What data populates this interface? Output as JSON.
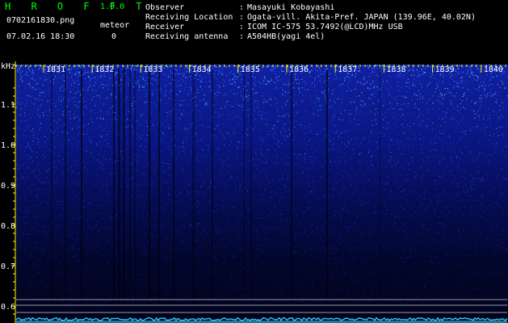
{
  "app": {
    "title": "H R O F F T",
    "version": "1.0.0"
  },
  "file": {
    "name": "0702161830.png",
    "datetime": "07.02.16 18:30"
  },
  "meteor": {
    "label": "meteor",
    "count": "0"
  },
  "info": [
    {
      "label": "Observer",
      "value": "Masayuki Kobayashi"
    },
    {
      "label": "Receiving Location",
      "value": "Ogata-vill. Akita-Pref. JAPAN (139.96E, 40.02N)"
    },
    {
      "label": "Receiver",
      "value": "ICOM IC-575 53.7492(@LCD)MHz USB"
    },
    {
      "label": "Receiving antenna",
      "value": "A504HB(yagi 4el)"
    }
  ],
  "axis": {
    "unit": "kHz",
    "y_labels": [
      "1.1",
      "1.0",
      "0.9",
      "0.8",
      "0.7",
      "0.6"
    ],
    "time_labels": [
      "1831",
      "1832",
      "1833",
      "1834",
      "1835",
      "1836",
      "1837",
      "1838",
      "1839",
      "1840"
    ]
  },
  "colors": {
    "background": "#000000",
    "title_green": "#00ff00",
    "text": "#ffffff",
    "scale": "#ffff00",
    "signal_blue": "#1a3cff",
    "noise_cyan": "#33ccff",
    "carrier_line": "#9a9ab0"
  }
}
